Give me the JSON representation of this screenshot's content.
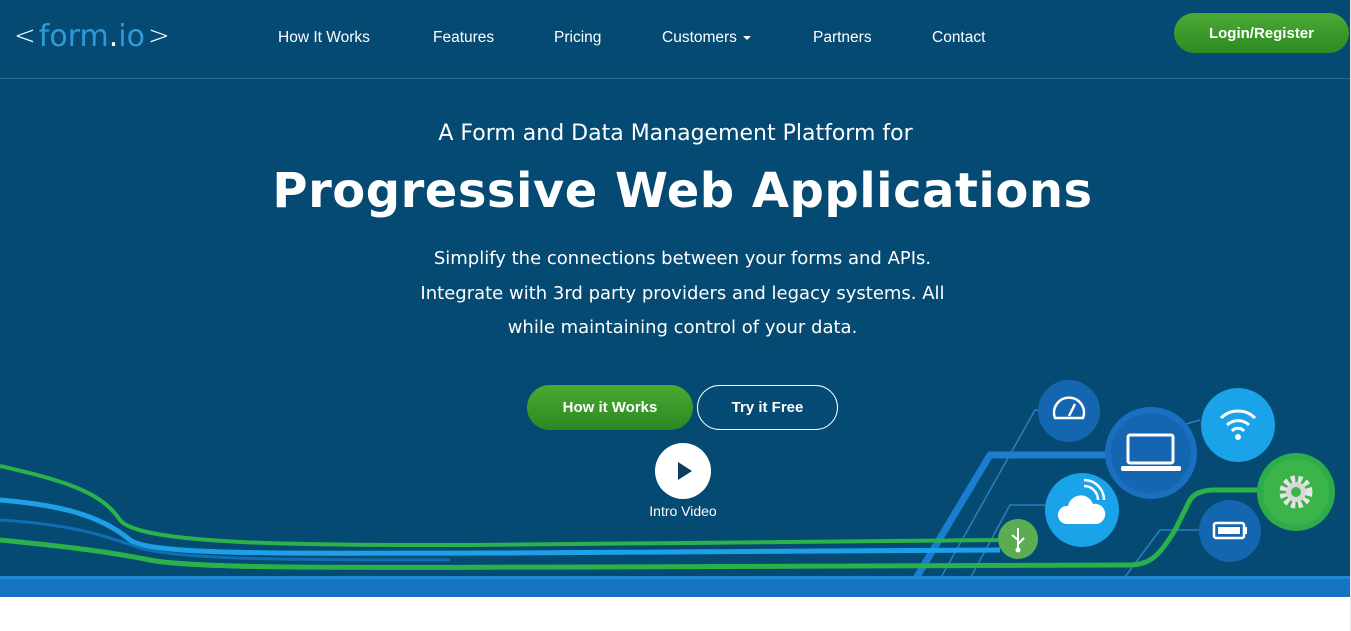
{
  "logo": {
    "open": "<",
    "word": "form",
    "dot": ".",
    "suffix": "io",
    "close": ">"
  },
  "nav": {
    "links": [
      "How It Works",
      "Features",
      "Pricing",
      "Customers",
      "Partners",
      "Contact"
    ],
    "login_label": "Login/Register"
  },
  "hero": {
    "subtitle": "A Form and Data Management Platform for",
    "title": "Progressive Web Applications",
    "description_lines": [
      "Simplify the connections between your forms and APIs.",
      "Integrate with 3rd party providers and legacy systems. All",
      "while maintaining control of your data."
    ],
    "how_button": "How it Works",
    "try_button": "Try it Free",
    "intro_video_label": "Intro Video"
  },
  "colors": {
    "hero_bg": "#054a72",
    "brand_blue": "#2e9ad9",
    "green": "#3a9a2c",
    "light_blue": "#1aa3e8"
  },
  "icons": [
    "dashboard-icon",
    "laptop-icon",
    "wifi-icon",
    "cloud-icon",
    "gear-icon",
    "usb-icon",
    "battery-icon",
    "play-icon"
  ]
}
